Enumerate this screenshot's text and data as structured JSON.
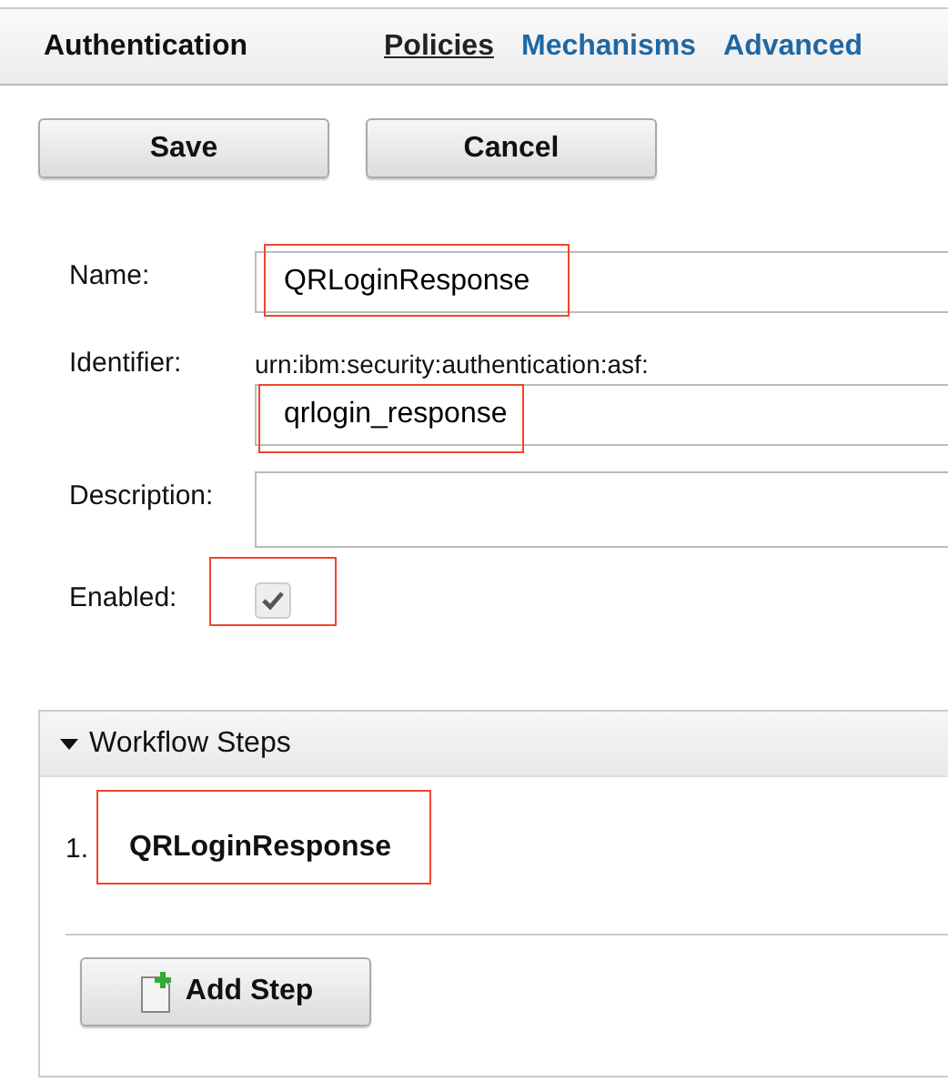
{
  "header": {
    "title": "Authentication",
    "tabs": [
      {
        "label": "Policies",
        "selected": true
      },
      {
        "label": "Mechanisms",
        "selected": false
      },
      {
        "label": "Advanced",
        "selected": false
      }
    ]
  },
  "buttons": [
    "Save",
    "Cancel"
  ],
  "form": {
    "fields": [
      {
        "kind": "text",
        "label": "Name:",
        "value": "QRLoginResponse",
        "highlighted": true
      },
      {
        "kind": "text",
        "label": "Identifier:",
        "prefix": "urn:ibm:security:authentication:asf:",
        "value": "qrlogin_response",
        "highlighted": true
      },
      {
        "kind": "textarea",
        "label": "Description:"
      },
      {
        "kind": "checkbox",
        "label": "Enabled:",
        "checked": true,
        "highlighted": true
      }
    ]
  },
  "workflow": {
    "title": "Workflow Steps",
    "expanded": true,
    "steps": [
      {
        "number": "1.",
        "name": "QRLoginResponse",
        "highlighted": true
      }
    ],
    "add_button": "Add Step"
  }
}
